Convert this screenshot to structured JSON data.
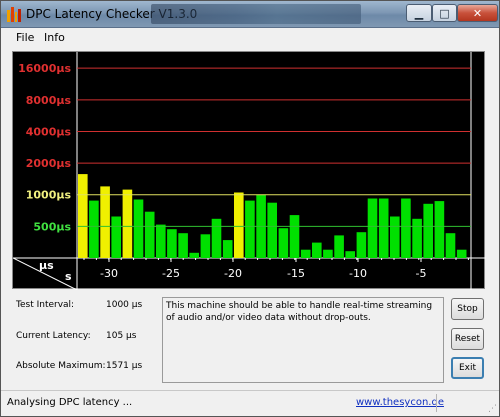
{
  "window": {
    "title": "DPC Latency Checker V1.3.0",
    "minimize_glyph": "▁",
    "maximize_glyph": "□",
    "close_glyph": "✕"
  },
  "menu": {
    "file": "File",
    "info": "Info"
  },
  "chart_data": {
    "type": "bar",
    "ylabel": "µs",
    "xlabel": "s",
    "y_ticks": [
      "16000µs",
      "8000µs",
      "4000µs",
      "2000µs",
      "1000µs",
      "500µs"
    ],
    "x_ticks": [
      "-30",
      "-25",
      "-20",
      "-15",
      "-10",
      "-5"
    ],
    "y_scale": "log",
    "bar_colors": {
      "normal": "#00e000",
      "warning": "#f0f000"
    },
    "bars": [
      {
        "value": 1571,
        "status": "warning"
      },
      {
        "value": 880,
        "status": "normal"
      },
      {
        "value": 1200,
        "status": "warning"
      },
      {
        "value": 620,
        "status": "normal"
      },
      {
        "value": 1120,
        "status": "warning"
      },
      {
        "value": 900,
        "status": "normal"
      },
      {
        "value": 690,
        "status": "normal"
      },
      {
        "value": 520,
        "status": "normal"
      },
      {
        "value": 470,
        "status": "normal"
      },
      {
        "value": 430,
        "status": "normal"
      },
      {
        "value": 280,
        "status": "normal"
      },
      {
        "value": 420,
        "status": "normal"
      },
      {
        "value": 590,
        "status": "normal"
      },
      {
        "value": 370,
        "status": "normal"
      },
      {
        "value": 1050,
        "status": "warning"
      },
      {
        "value": 880,
        "status": "normal"
      },
      {
        "value": 1000,
        "status": "normal"
      },
      {
        "value": 840,
        "status": "normal"
      },
      {
        "value": 480,
        "status": "normal"
      },
      {
        "value": 640,
        "status": "normal"
      },
      {
        "value": 300,
        "status": "normal"
      },
      {
        "value": 350,
        "status": "normal"
      },
      {
        "value": 300,
        "status": "normal"
      },
      {
        "value": 410,
        "status": "normal"
      },
      {
        "value": 290,
        "status": "normal"
      },
      {
        "value": 440,
        "status": "normal"
      },
      {
        "value": 920,
        "status": "normal"
      },
      {
        "value": 920,
        "status": "normal"
      },
      {
        "value": 620,
        "status": "normal"
      },
      {
        "value": 920,
        "status": "normal"
      },
      {
        "value": 590,
        "status": "normal"
      },
      {
        "value": 820,
        "status": "normal"
      },
      {
        "value": 870,
        "status": "normal"
      },
      {
        "value": 430,
        "status": "normal"
      },
      {
        "value": 300,
        "status": "normal"
      }
    ]
  },
  "stats": {
    "test_interval_label": "Test Interval:",
    "test_interval_value": "1000 µs",
    "current_latency_label": "Current Latency:",
    "current_latency_value": "105 µs",
    "absolute_maximum_label": "Absolute Maximum:",
    "absolute_maximum_value": "1571 µs"
  },
  "message": "This machine should be able to handle real-time streaming of audio and/or video data without drop-outs.",
  "buttons": {
    "stop": "Stop",
    "reset": "Reset",
    "exit": "Exit"
  },
  "status": {
    "text": "Analysing DPC latency ...",
    "link": "www.thesycon.de"
  }
}
